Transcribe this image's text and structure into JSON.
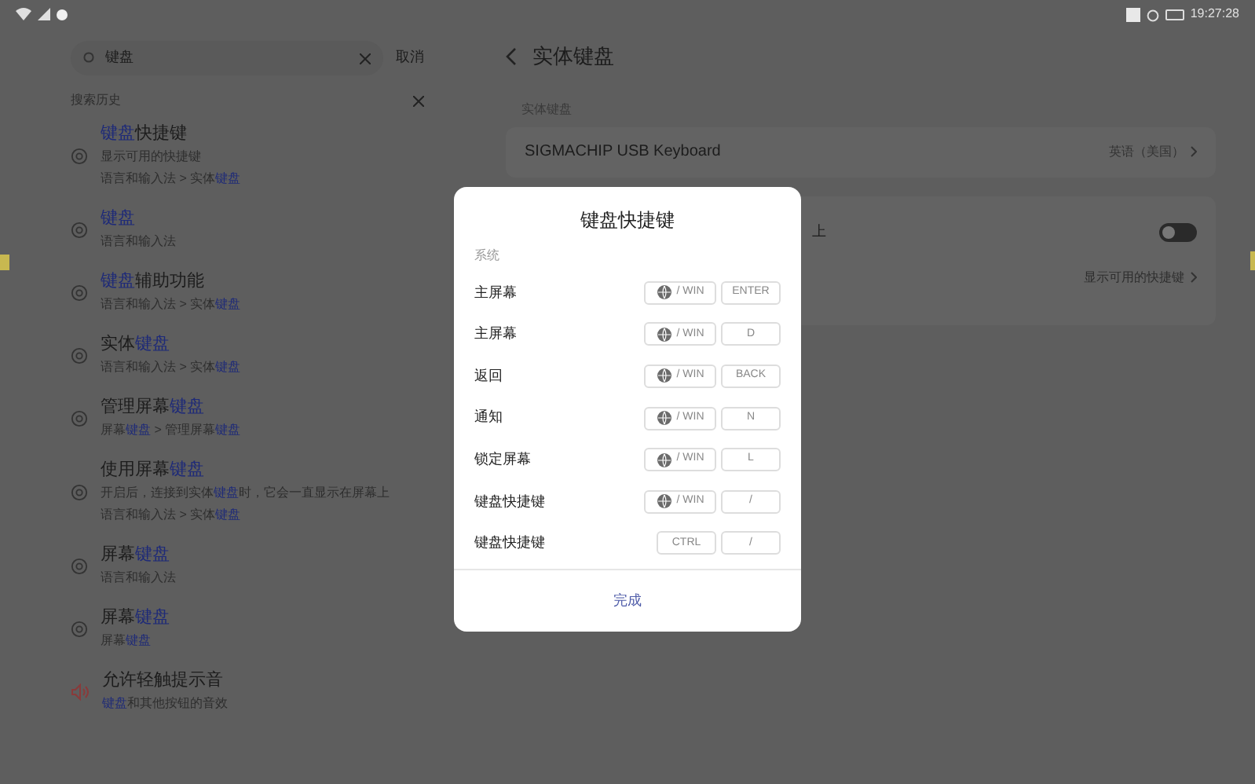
{
  "status_bar": {
    "time": "19:27:28"
  },
  "search": {
    "value": "键盘",
    "cancel": "取消"
  },
  "history": {
    "title": "搜索历史"
  },
  "results": [
    {
      "kind": "gear",
      "title": "**键盘**快捷键",
      "lines": [
        "显示可用的快捷键",
        "语言和输入法 > 实体**键盘**"
      ]
    },
    {
      "kind": "gear",
      "title": "**键盘**",
      "lines": [
        "语言和输入法"
      ]
    },
    {
      "kind": "gear",
      "title": "**键盘**辅助功能",
      "lines": [
        "语言和输入法 > 实体**键盘**"
      ]
    },
    {
      "kind": "gear",
      "title": "实体**键盘**",
      "lines": [
        "语言和输入法 > 实体**键盘**"
      ]
    },
    {
      "kind": "gear",
      "title": "管理屏幕**键盘**",
      "lines": [
        "屏幕**键盘** > 管理屏幕**键盘**"
      ]
    },
    {
      "kind": "gear",
      "title": "使用屏幕**键盘**",
      "lines": [
        "开启后，连接到实体**键盘**时，它会一直显示在屏幕上",
        "语言和输入法 > 实体**键盘**"
      ]
    },
    {
      "kind": "gear",
      "title": "屏幕**键盘**",
      "lines": [
        "语言和输入法"
      ]
    },
    {
      "kind": "gear",
      "title": "屏幕**键盘**",
      "lines": [
        "屏幕**键盘**"
      ]
    },
    {
      "kind": "sound",
      "title": "允许轻触提示音",
      "lines": [
        "**键盘**和其他按钮的音效"
      ]
    }
  ],
  "detail": {
    "title": "实体键盘",
    "section_label": "实体键盘",
    "device": {
      "name": "SIGMACHIP USB Keyboard",
      "layout": "英语（美国）"
    },
    "toggle_row": {
      "text": "上",
      "on": false
    },
    "link": "显示可用的快捷键"
  },
  "dialog": {
    "title": "键盘快捷键",
    "section": "系统",
    "shortcuts": [
      {
        "label": "主屏幕",
        "keys": [
          {
            "kind": "meta",
            "text": "/ WIN"
          },
          {
            "kind": "key",
            "text": "ENTER"
          }
        ]
      },
      {
        "label": "主屏幕",
        "keys": [
          {
            "kind": "meta",
            "text": "/ WIN"
          },
          {
            "kind": "key",
            "text": "D"
          }
        ]
      },
      {
        "label": "返回",
        "keys": [
          {
            "kind": "meta",
            "text": "/ WIN"
          },
          {
            "kind": "key",
            "text": "BACK"
          }
        ]
      },
      {
        "label": "通知",
        "keys": [
          {
            "kind": "meta",
            "text": "/ WIN"
          },
          {
            "kind": "key",
            "text": "N"
          }
        ]
      },
      {
        "label": "锁定屏幕",
        "keys": [
          {
            "kind": "meta",
            "text": "/ WIN"
          },
          {
            "kind": "key",
            "text": "L"
          }
        ]
      },
      {
        "label": "键盘快捷键",
        "keys": [
          {
            "kind": "meta",
            "text": "/ WIN"
          },
          {
            "kind": "key",
            "text": "/"
          }
        ]
      },
      {
        "label": "键盘快捷键",
        "keys": [
          {
            "kind": "key",
            "text": "CTRL"
          },
          {
            "kind": "key",
            "text": "/"
          }
        ]
      }
    ],
    "done": "完成"
  }
}
